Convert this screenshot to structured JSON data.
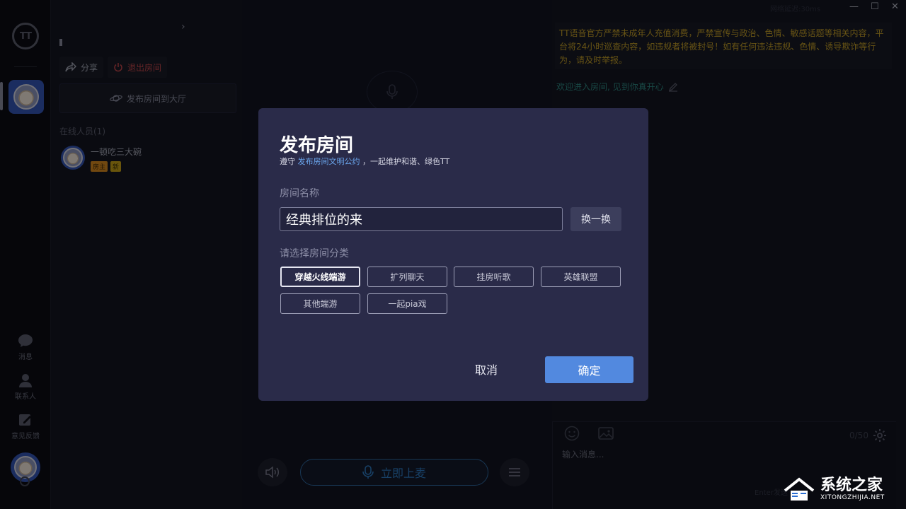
{
  "app": {
    "logo_text": "TT"
  },
  "nav": {
    "items": [
      {
        "label": "消息",
        "icon": "message-icon"
      },
      {
        "label": "联系人",
        "icon": "contacts-icon"
      },
      {
        "label": "意见反馈",
        "icon": "feedback-icon"
      }
    ]
  },
  "left_panel": {
    "share_label": "分享",
    "exit_label": "退出房间",
    "publish_hall_label": "发布房间到大厅",
    "online_title": "在线人员(1)",
    "member": {
      "name": "一顿吃三大碗",
      "tags": [
        "房主",
        "新"
      ]
    }
  },
  "center": {
    "join_mic_label": "立即上麦"
  },
  "right_panel": {
    "ping_text": "网络延迟:30ms",
    "notice": "TT语音官方严禁未成年人充值消费，严禁宣传与政治、色情、敏感话题等相关内容，平台将24小时巡查内容，如违规者将被封号！如有任何违法违规、色情、诱导欺诈等行为，请及时举报。",
    "welcome": "欢迎进入房间, 见到你真开心",
    "chat": {
      "placeholder": "输入消息...",
      "counter": "0/50",
      "enter_hint": "Enter发送"
    }
  },
  "modal": {
    "title": "发布房间",
    "subtitle_prefix": "遵守",
    "subtitle_link": "发布房间文明公约",
    "subtitle_suffix": "，一起维护和谐、绿色TT",
    "name_label": "房间名称",
    "name_value": "经典排位的来",
    "swap_label": "换一换",
    "category_label": "请选择房间分类",
    "categories": [
      "穿越火线端游",
      "扩列聊天",
      "挂房听歌",
      "英雄联盟",
      "其他端游",
      "一起pia戏"
    ],
    "selected_category": "穿越火线端游",
    "cancel_label": "取消",
    "confirm_label": "确定"
  },
  "watermark": {
    "main": "系统之家",
    "sub": "XITONGZHIJIA.NET"
  },
  "colors": {
    "modal_bg": "#2a2b49",
    "confirm": "#5289df",
    "notice_text": "#c5a028",
    "welcome_text": "#2f8a84",
    "exit_red": "#c5474c",
    "join_blue": "#2e7bc3"
  }
}
